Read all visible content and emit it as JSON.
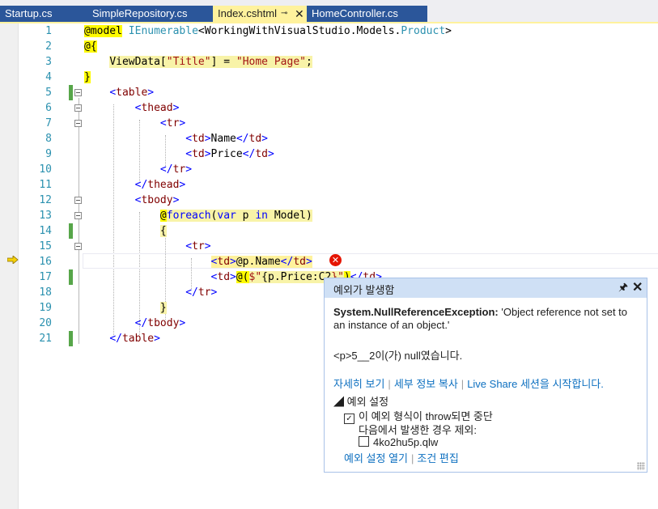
{
  "tabs": [
    {
      "label": "Startup.cs",
      "active": false
    },
    {
      "label": "SimpleRepository.cs",
      "active": false
    },
    {
      "label": "Index.cshtml",
      "active": true
    },
    {
      "label": "HomeController.cs",
      "active": false
    }
  ],
  "tab_pin_glyph": "⊸",
  "tab_close_glyph": "✕",
  "code": {
    "line_numbers": [
      "1",
      "2",
      "3",
      "4",
      "5",
      "6",
      "7",
      "8",
      "9",
      "10",
      "11",
      "12",
      "13",
      "14",
      "15",
      "16",
      "17",
      "18",
      "19",
      "20",
      "21"
    ],
    "l1": {
      "at": "@model",
      "sp": " ",
      "type": "IEnumerable",
      "lt": "<",
      "ns": "WorkingWithVisualStudio.Models.",
      "cls": "Product",
      "gt": ">"
    },
    "l2": {
      "text": "@{"
    },
    "l3": {
      "indent": "    ",
      "a": "ViewData[",
      "str1": "\"Title\"",
      "b": "] = ",
      "str2": "\"Home Page\"",
      "c": ";"
    },
    "l4": {
      "text": "}"
    },
    "l5": {
      "indent": "    ",
      "lt": "<",
      "tag": "table",
      "gt": ">"
    },
    "l6": {
      "indent": "        ",
      "lt": "<",
      "tag": "thead",
      "gt": ">"
    },
    "l7": {
      "indent": "            ",
      "lt": "<",
      "tag": "tr",
      "gt": ">"
    },
    "l8": {
      "indent": "                ",
      "lt": "<",
      "tag": "td",
      "gt": ">",
      "text": "Name",
      "clt": "</",
      "ctag": "td",
      "cgt": ">"
    },
    "l9": {
      "indent": "                ",
      "lt": "<",
      "tag": "td",
      "gt": ">",
      "text": "Price",
      "clt": "</",
      "ctag": "td",
      "cgt": ">"
    },
    "l10": {
      "indent": "            ",
      "lt": "</",
      "tag": "tr",
      "gt": ">"
    },
    "l11": {
      "indent": "        ",
      "lt": "</",
      "tag": "thead",
      "gt": ">"
    },
    "l12": {
      "indent": "        ",
      "lt": "<",
      "tag": "tbody",
      "gt": ">"
    },
    "l13": {
      "indent": "            ",
      "at": "@",
      "kw": "foreach",
      "p1": "(",
      "var": "var",
      "mid": " p ",
      "in": "in",
      "rest": " Model)"
    },
    "l14": {
      "indent": "            ",
      "text": "{"
    },
    "l15": {
      "indent": "                ",
      "lt": "<",
      "tag": "tr",
      "gt": ">"
    },
    "l16": {
      "indent": "                    ",
      "lt": "<",
      "tag": "td",
      "gt": ">",
      "expr": "@p.Name",
      "clt": "</",
      "ctag": "td",
      "cgt": ">"
    },
    "l17": {
      "indent": "                    ",
      "lt": "<",
      "tag": "td",
      "gt": ">",
      "at": "@(",
      "dollar": "$",
      "q": "\"",
      "expr": "{p.Price:C2",
      "tail": "}\"",
      "close": ")",
      "clt": "</",
      "ctag": "td",
      "cgt": ">"
    },
    "l18": {
      "indent": "                ",
      "lt": "</",
      "tag": "tr",
      "gt": ">"
    },
    "l19": {
      "indent": "            ",
      "text": "}"
    },
    "l20": {
      "indent": "        ",
      "lt": "</",
      "tag": "tbody",
      "gt": ">"
    },
    "l21": {
      "indent": "    ",
      "lt": "</",
      "tag": "table",
      "gt": ">"
    }
  },
  "error_glyph": "✕",
  "popup": {
    "title": "예외가 발생함",
    "pin_glyph": "🖈",
    "close_glyph": "✕",
    "exception_type": "System.NullReferenceException:",
    "exception_message": " 'Object reference not set to an instance of an object.'",
    "detail": "<p>5__2이(가) null였습니다.",
    "links": [
      "자세히 보기",
      "세부 정보 복사",
      "Live Share 세션을 시작합니다."
    ],
    "settings_header": "◢ 예외 설정",
    "break_when_thrown": "이 예외 형식이 throw되면 중단",
    "except_when_from": "다음에서 발생한 경우 제외:",
    "module": "4ko2hu5p.qlw",
    "check_glyph": "✓",
    "bottom_links": [
      "예외 설정 열기",
      "조건 편집"
    ]
  }
}
